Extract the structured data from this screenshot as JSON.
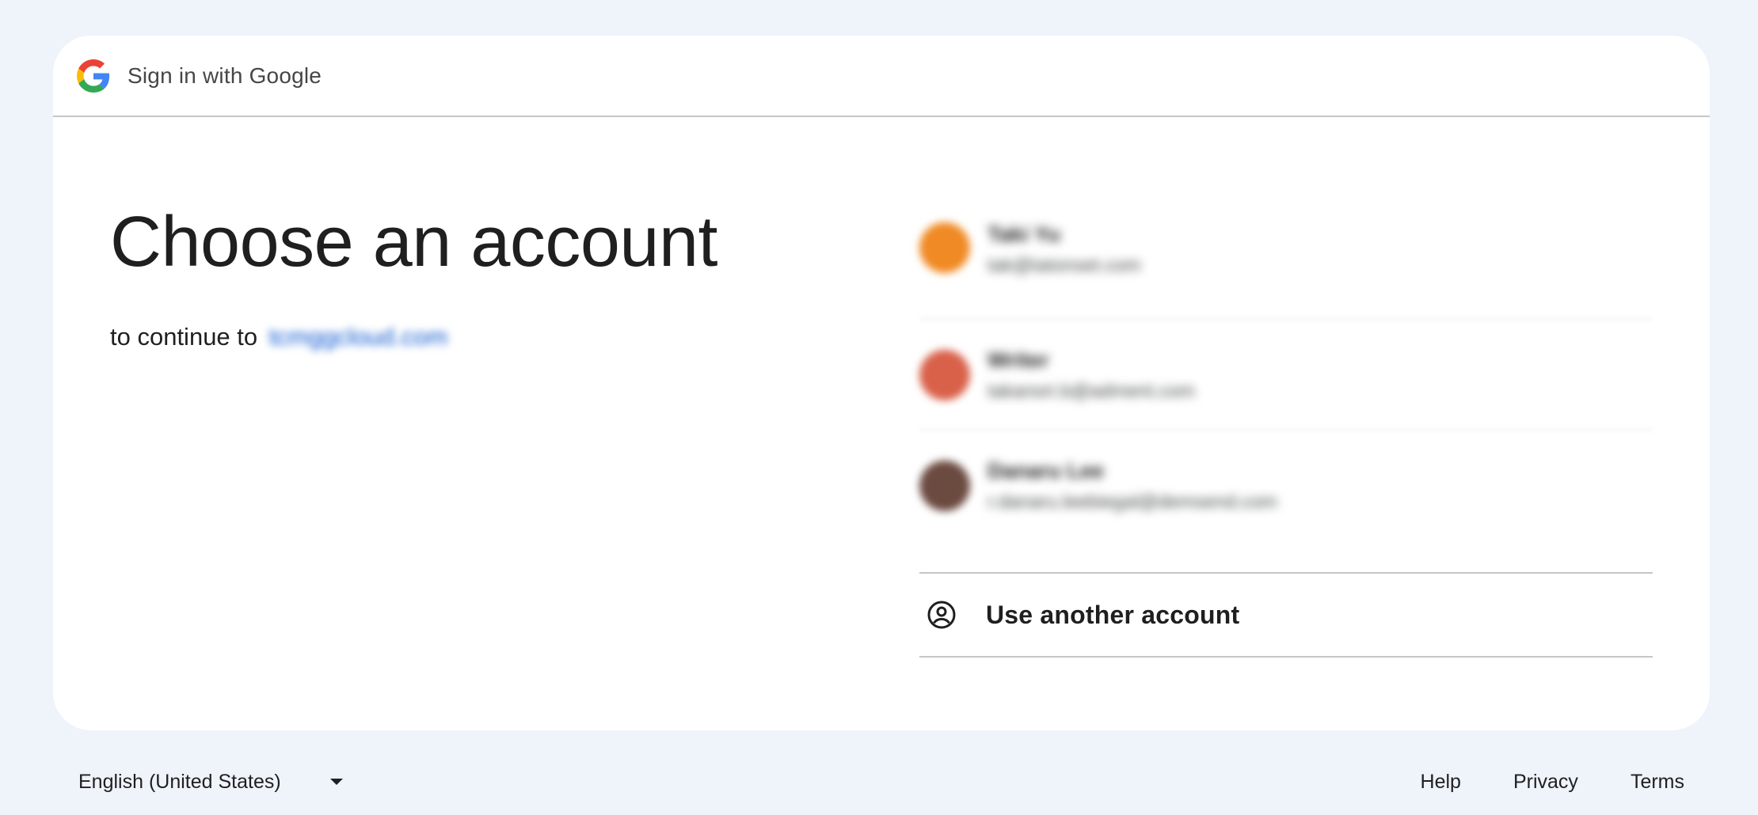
{
  "header": {
    "title": "Sign in with Google"
  },
  "main": {
    "title": "Choose an account",
    "subtitle_prefix": "to continue to",
    "destination": "tcmggcloud.com"
  },
  "accounts": [
    {
      "name": "Taki Yu",
      "email": "tak@tatonset.com",
      "avatar_color": "#f08a24"
    },
    {
      "name": "Writer",
      "email": "takanori.b@adment.com",
      "avatar_color": "#d9614a"
    },
    {
      "name": "Danaru Lee",
      "email": "r.danaru.leebiegal@demsend.com",
      "avatar_color": "#6b4a40"
    }
  ],
  "use_another": {
    "label": "Use another account",
    "icon": "account-circle-icon"
  },
  "footer": {
    "language": "English (United States)",
    "links": [
      "Help",
      "Privacy",
      "Terms"
    ]
  },
  "colors": {
    "page_bg": "#eff3fa",
    "card_bg": "#ffffff",
    "link": "#0b57d0",
    "divider": "#c4c7c5"
  }
}
